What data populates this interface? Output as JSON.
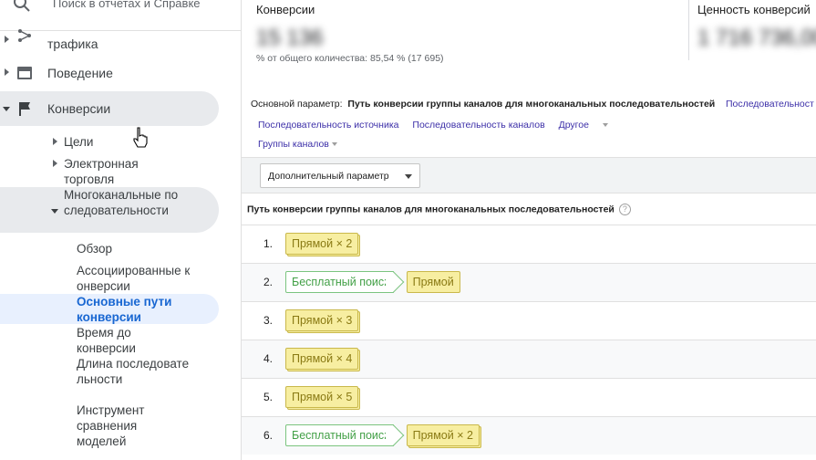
{
  "sidebar": {
    "search_placeholder": "Поиск в отчетах и Справке",
    "items": [
      {
        "label": "трафика",
        "icon": "acquisition-icon"
      },
      {
        "label": "Поведение",
        "icon": "behavior-icon"
      },
      {
        "label": "Конверсии",
        "icon": "flag-icon"
      }
    ],
    "sub_items": [
      {
        "label": "Цели"
      },
      {
        "label": "Электронная торговля"
      },
      {
        "label": "Многоканальные последовательности"
      }
    ],
    "leaves": [
      {
        "label": "Обзор"
      },
      {
        "label": "Ассоциированные конверсии"
      },
      {
        "label": "Основные пути конверсии"
      },
      {
        "label": "Время до конверсии"
      },
      {
        "label": "Длина последовательности"
      },
      {
        "label": "Инструмент сравнения моделей"
      }
    ],
    "selected_leaf": "Основные пути конверсии"
  },
  "metrics": [
    {
      "title": "Конверсии",
      "value": "15 136",
      "subtitle": "% от общего количества: 85,54 % (17 695)"
    },
    {
      "title": "Ценность конверсий",
      "value": "1 716 736,00",
      "subtitle": ""
    }
  ],
  "dimensions": {
    "label": "Основной параметр:",
    "current": "Путь конверсии группы каналов для многоканальных последовательностей",
    "truncated_link": "Последовательност",
    "links": [
      "Последовательность источника",
      "Последовательность каналов",
      "Другое"
    ],
    "links2": [
      "Группы каналов"
    ]
  },
  "toolbar": {
    "secondary_dimension": "Дополнительный параметр"
  },
  "table": {
    "header": "Путь конверсии группы каналов для многоканальных последовательностей",
    "help": "?",
    "rows": [
      {
        "num": "1.",
        "chips": [
          {
            "type": "direct",
            "label": "Прямой × 2"
          }
        ]
      },
      {
        "num": "2.",
        "chips": [
          {
            "type": "organic",
            "label": "Бесплатный поиск"
          },
          {
            "type": "direct",
            "label": "Прямой"
          }
        ]
      },
      {
        "num": "3.",
        "chips": [
          {
            "type": "direct",
            "label": "Прямой × 3"
          }
        ]
      },
      {
        "num": "4.",
        "chips": [
          {
            "type": "direct",
            "label": "Прямой × 4"
          }
        ]
      },
      {
        "num": "5.",
        "chips": [
          {
            "type": "direct",
            "label": "Прямой × 5"
          }
        ]
      },
      {
        "num": "6.",
        "chips": [
          {
            "type": "organic",
            "label": "Бесплатный поиск"
          },
          {
            "type": "direct",
            "label": "Прямой × 2"
          }
        ]
      }
    ]
  },
  "colors": {
    "accent": "#1967d2",
    "link": "#3c2fa8",
    "direct_chip": "#f7eea1",
    "organic_chip_border": "#7bc47f"
  }
}
